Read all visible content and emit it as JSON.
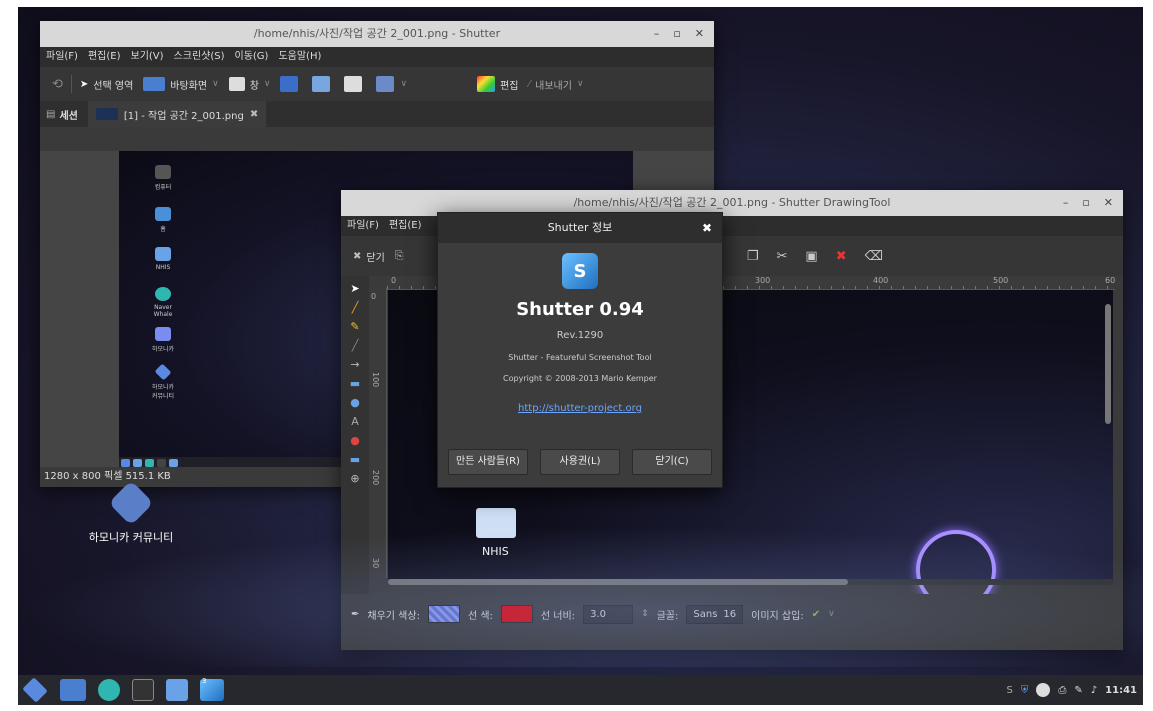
{
  "shutter_window": {
    "title": "/home/nhis/사진/작업 공간 2_001.png - Shutter",
    "menu": [
      "파일(F)",
      "편집(E)",
      "보기(V)",
      "스크린샷(S)",
      "이동(G)",
      "도움말(H)"
    ],
    "toolbar": {
      "selection": "선택 영역",
      "desktop": "바탕화면",
      "window": "창",
      "edit": "편집",
      "export": "내보내기"
    },
    "session_label": "세션",
    "tab_label": "[1] - 작업 공간 2_001.png",
    "status": "1280 x 800 픽셀  515.1 KB",
    "preview_icons": [
      "컴퓨터",
      "홈",
      "NHIS",
      "Naver Whale",
      "하모니카",
      "하모니카 커뮤니티"
    ]
  },
  "drawing_window": {
    "title": "/home/nhis/사진/작업 공간 2_001.png - Shutter DrawingTool",
    "menu": [
      "파일(F)",
      "편집(E)"
    ],
    "close_label": "닫기",
    "ruler_labels": [
      "0",
      "300",
      "400",
      "500",
      "60"
    ],
    "vruler_labels": [
      "0",
      "100",
      "200",
      "30"
    ],
    "canvas_folder_label": "NHIS",
    "props": {
      "fill_color_label": "채우기 색상:",
      "stroke_color_label": "선 색:",
      "stroke_width_label": "선 너비:",
      "stroke_width_value": "3.0",
      "font_label": "글꼴:",
      "font_name": "Sans",
      "font_size": "16",
      "insert_image_label": "이미지 삽입:"
    },
    "colors": {
      "stroke": "#e30000",
      "fill": "#5c6fd8"
    }
  },
  "about_dialog": {
    "title": "Shutter 정보",
    "name": "Shutter 0.94",
    "revision": "Rev.1290",
    "description": "Shutter - Featureful Screenshot Tool",
    "copyright": "Copyright © 2008-2013 Mario Kemper",
    "link": "http://shutter-project.org",
    "buttons": {
      "credits": "만든 사람들(R)",
      "license": "사용권(L)",
      "close": "닫기(C)"
    }
  },
  "desktop": {
    "icon_label": "하모니카 커뮤니티"
  },
  "taskbar": {
    "clock": "11:41",
    "badge": "3"
  }
}
